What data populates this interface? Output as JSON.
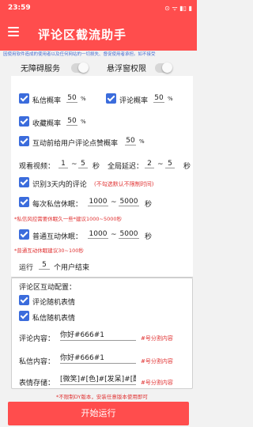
{
  "status": {
    "time": "23:59",
    "icons": "⊙ ᯤ ▮▯ ▮"
  },
  "app": {
    "title": "评论区截流助手"
  },
  "notice": "因使用软件造成的使用者以及任何网站的一切损失、督促使用者承担。如不接受",
  "permissions": {
    "accessibility": "无障碍服务",
    "floating": "悬浮窗权限"
  },
  "settings": {
    "dm_rate": {
      "label": "私信概率",
      "value": "50",
      "unit": "%"
    },
    "comment_rate": {
      "label": "评论概率",
      "value": "50",
      "unit": "%"
    },
    "fav_rate": {
      "label": "收藏概率",
      "value": "50",
      "unit": "%"
    },
    "like_rate": {
      "label": "互动前给用户评论点赞概率",
      "value": "50",
      "unit": "%"
    },
    "watch": {
      "label": "观看视频：",
      "min": "1",
      "sep": "~",
      "max": "5",
      "unit": "秒"
    },
    "delay": {
      "label": "全局延迟：",
      "min": "2",
      "sep": "~",
      "max": "5",
      "unit": "秒"
    },
    "recent": {
      "label": "识别3天内的评论",
      "hint": "(不勾选默认不限制时间)"
    },
    "dm_rest": {
      "label": "每次私信休眠：",
      "min": "1000",
      "sep": "~",
      "max": "5000",
      "unit": "秒"
    },
    "dm_warn": "*私信风控需要休眠久一些*建议1000~5000秒",
    "act_rest": {
      "label": "普通互动休眠：",
      "min": "1000",
      "sep": "~",
      "max": "5000",
      "unit": "秒"
    },
    "act_warn": "*普通互动休眠建议30~100秒",
    "run": {
      "prefix": "运行",
      "value": "5",
      "suffix": "个用户结束"
    }
  },
  "interact": {
    "title": "评论区互动配置：",
    "random_comment": "评论随机表情",
    "random_dm": "私信随机表情",
    "comment_label": "评论内容：",
    "comment_value": "你好#666#1",
    "comment_hint": "#号分割内容",
    "dm_label": "私信内容：",
    "dm_value": "你好#666#1",
    "dm_hint": "#号分割内容",
    "emoji_label": "表情存储：",
    "emoji_value": "[微笑]#[色]#[发呆]#[酷",
    "emoji_hint": "#号分割内容"
  },
  "footer_note": "*不限制DY版本，安装任意版本使用即可",
  "run_button": "开始运行"
}
